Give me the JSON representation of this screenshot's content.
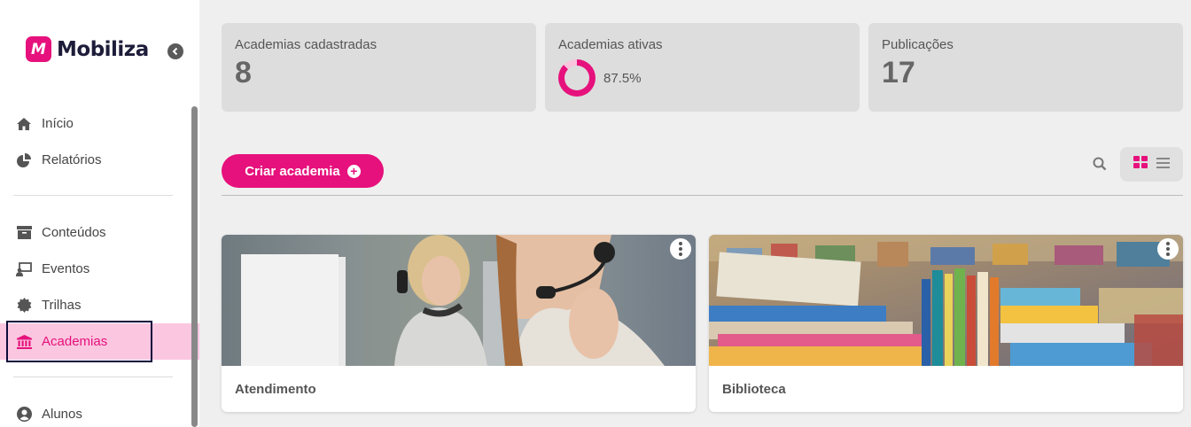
{
  "brand": {
    "name": "Mobiliza",
    "mark": "M",
    "accent": "#e6117c"
  },
  "sidebar": {
    "collapse_icon": "chevron-left-circle-icon",
    "items": [
      {
        "label": "Início",
        "icon": "home-icon"
      },
      {
        "label": "Relatórios",
        "icon": "pie-chart-icon"
      },
      {
        "label": "Conteúdos",
        "icon": "archive-icon"
      },
      {
        "label": "Eventos",
        "icon": "presentation-icon"
      },
      {
        "label": "Trilhas",
        "icon": "badge-icon"
      },
      {
        "label": "Academias",
        "icon": "institution-icon",
        "active": true
      },
      {
        "label": "Alunos",
        "icon": "user-circle-icon"
      }
    ]
  },
  "stats": [
    {
      "title": "Academias cadastradas",
      "value": "8"
    },
    {
      "title": "Academias ativas",
      "value": "87.5%",
      "fraction": 0.875
    },
    {
      "title": "Publicações",
      "value": "17"
    }
  ],
  "toolbar": {
    "create_label": "Criar academia",
    "search_icon": "search-icon",
    "view_modes": [
      "grid",
      "list"
    ],
    "active_view": "grid"
  },
  "academies": [
    {
      "title": "Atendimento",
      "image": "call-center-photo"
    },
    {
      "title": "Biblioteca",
      "image": "bookshelf-photo"
    }
  ]
}
